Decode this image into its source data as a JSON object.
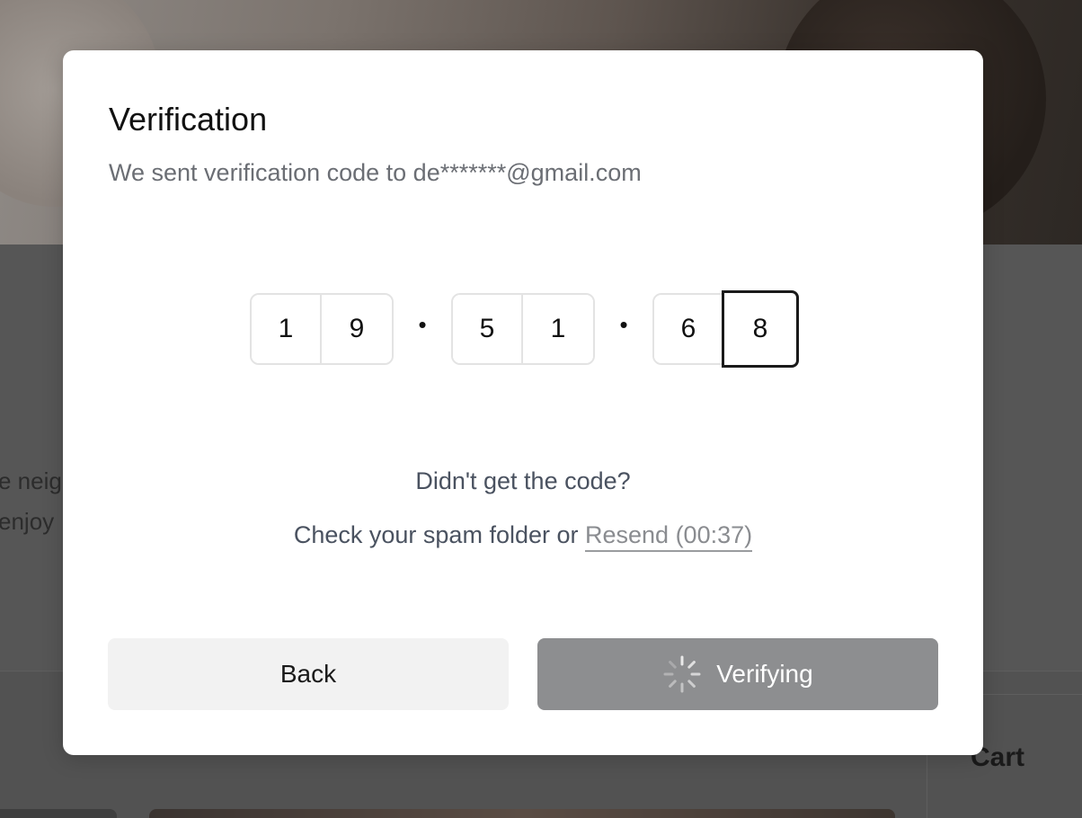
{
  "background": {
    "text_line_1": "e neig",
    "text_line_2": "enjoy",
    "cart_label": "Cart"
  },
  "modal": {
    "title": "Verification",
    "subtitle": "We sent verification code to de*******@gmail.com",
    "code": {
      "groups": [
        [
          "1",
          "9"
        ],
        [
          "5",
          "1"
        ],
        [
          "6",
          "8"
        ]
      ],
      "separator": "•",
      "active_digit_index": 5
    },
    "help": {
      "question": "Didn't get the code?",
      "prefix": "Check your spam folder or ",
      "resend_label": "Resend (00:37)"
    },
    "buttons": {
      "back_label": "Back",
      "verify_label": "Verifying",
      "verify_state": "loading"
    }
  },
  "colors": {
    "overlay": "#4a4a4a",
    "modal_bg": "#ffffff",
    "verify_button": "#8d8e90",
    "back_button": "#f2f2f2",
    "active_border": "#1a1a1a"
  },
  "icons": {
    "spinner": "loading-spinner-icon"
  }
}
